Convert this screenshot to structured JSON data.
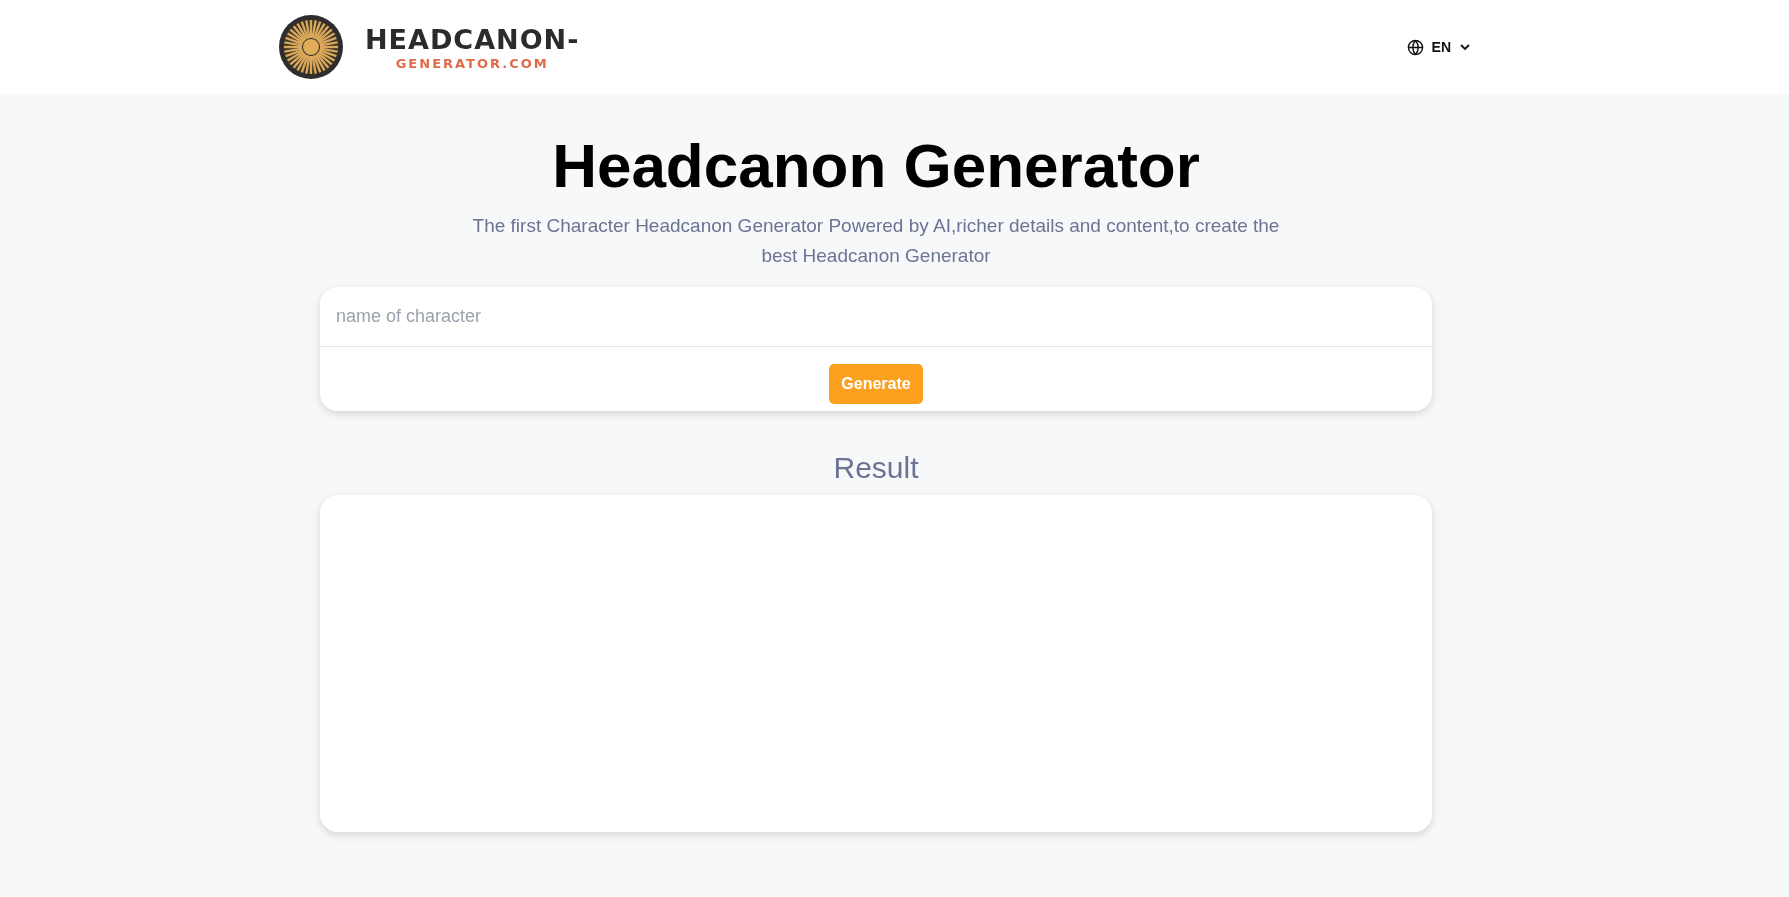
{
  "header": {
    "logo": {
      "line_1": "HEADCANON-",
      "line_2": "GENERATOR.COM"
    },
    "language": {
      "label": "EN"
    }
  },
  "hero": {
    "title": "Headcanon Generator",
    "subtitle": "The first Character Headcanon Generator Powered by AI,richer details and content,to create the best Headcanon Generator"
  },
  "form": {
    "input": {
      "placeholder": "name of character"
    },
    "button": "Generate"
  },
  "result": {
    "title": "Result"
  }
}
